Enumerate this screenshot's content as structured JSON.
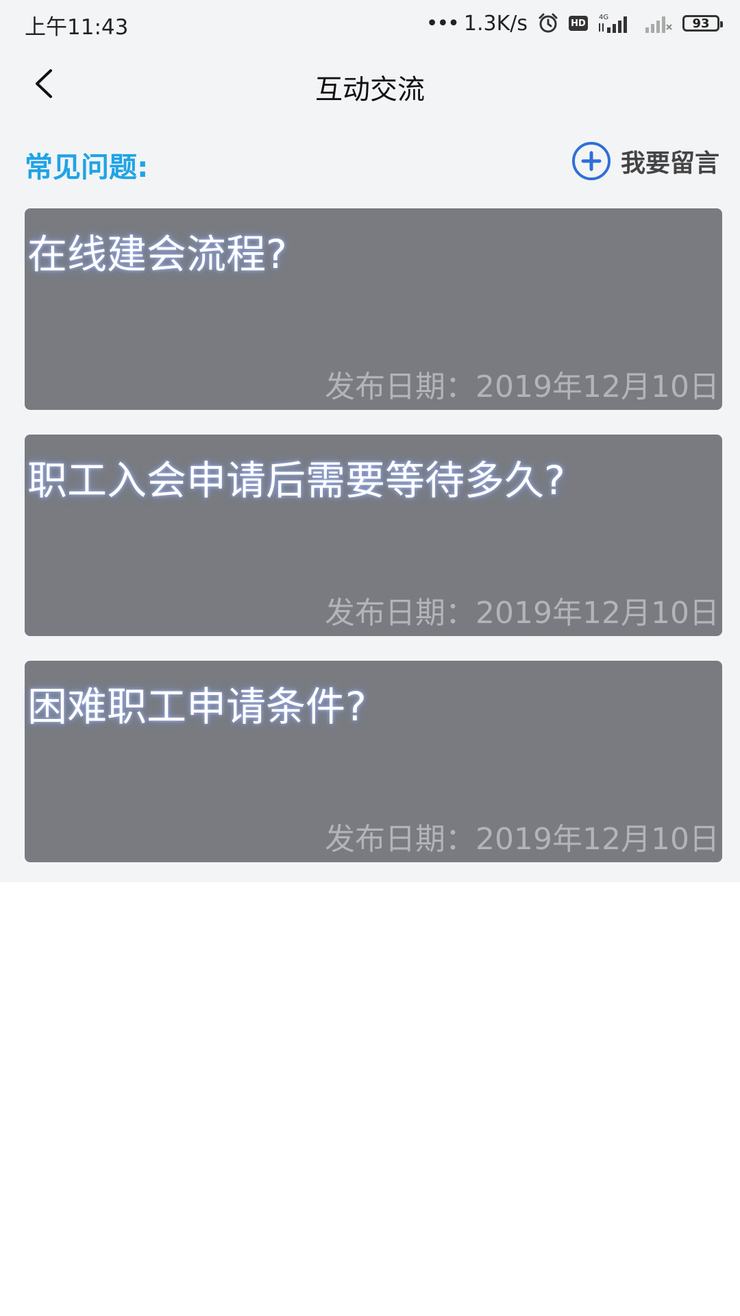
{
  "status_bar": {
    "time": "上午11:43",
    "speed": "1.3K/s",
    "hd": "HD",
    "network": "4G",
    "battery": "93"
  },
  "nav": {
    "title": "互动交流"
  },
  "section": {
    "title": "常见问题:",
    "leave_message_label": "我要留言"
  },
  "faq": [
    {
      "title": "在线建会流程?",
      "date": "发布日期：2019年12月10日"
    },
    {
      "title": "职工入会申请后需要等待多久?",
      "date": "发布日期：2019年12月10日"
    },
    {
      "title": "困难职工申请条件?",
      "date": "发布日期：2019年12月10日"
    }
  ],
  "colors": {
    "accent": "#1ea4e6",
    "plus_icon": "#2f6fd8",
    "card_bg": "#797b80"
  }
}
